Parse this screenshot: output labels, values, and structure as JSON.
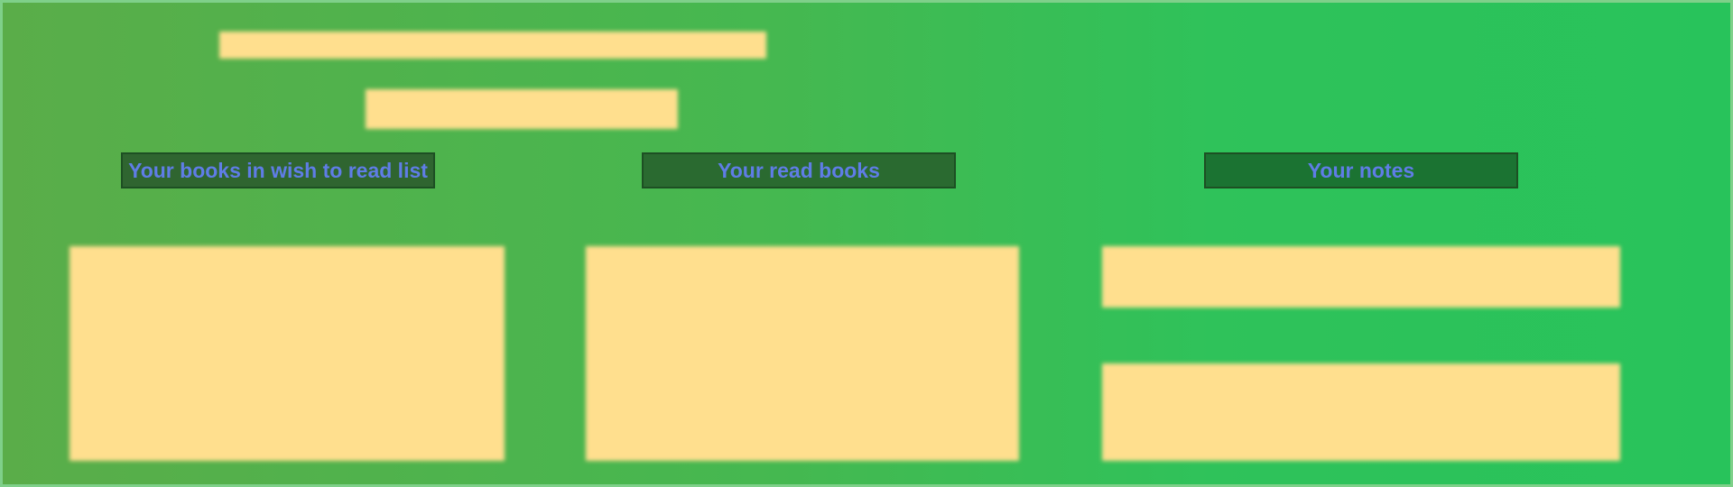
{
  "tabs": {
    "wish_list_label": "Your books in wish to read list",
    "read_books_label": "Your read books",
    "notes_label": "Your notes"
  },
  "colors": {
    "background_left": "#5aad49",
    "background_right": "#28c35b",
    "content_block": "#ffdf8e",
    "tab_text": "#5f7de6",
    "tab_border": "#1d4f23"
  }
}
